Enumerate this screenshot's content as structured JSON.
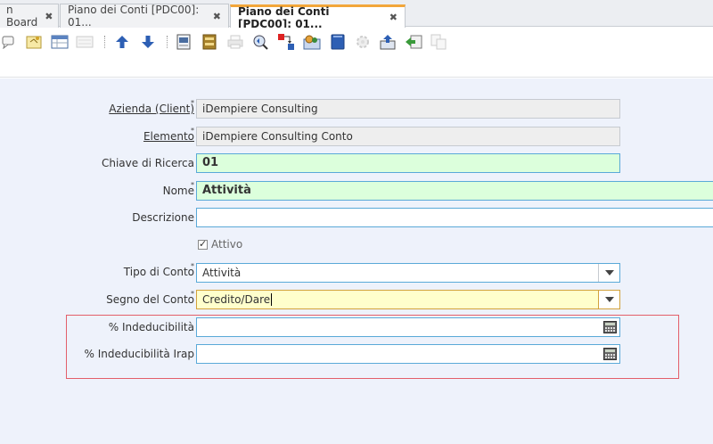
{
  "tabs": [
    {
      "label": "n Board",
      "close": "✖"
    },
    {
      "label": "Piano dei Conti [PDC00]: 01...",
      "close": "✖"
    },
    {
      "label": "Piano dei Conti [PDC00]: 01...",
      "close": "✖"
    }
  ],
  "toolbar": {
    "icons": [
      "chat-icon",
      "note-icon",
      "grid-toggle-icon",
      "multi-row-icon",
      "up-arrow-icon",
      "down-arrow-icon",
      "report-icon",
      "archive-icon",
      "print-icon",
      "zoom-across-icon",
      "request-icon",
      "product-info-icon",
      "attachment-icon",
      "workflow-icon",
      "export-icon",
      "import-icon",
      "copy-icon"
    ]
  },
  "form": {
    "client": {
      "label": "Azienda (Client)",
      "value": "iDempiere Consulting",
      "required": "*"
    },
    "element": {
      "label": "Elemento",
      "value": "iDempiere Consulting Conto",
      "required": "*"
    },
    "search_key": {
      "label": "Chiave di Ricerca",
      "value": "01"
    },
    "name": {
      "label": "Nome",
      "value": "Attività",
      "required": "*"
    },
    "description": {
      "label": "Descrizione",
      "value": ""
    },
    "active": {
      "label": "Attivo"
    },
    "account_type": {
      "label": "Tipo di Conto",
      "value": "Attività",
      "required": "*"
    },
    "account_sign": {
      "label": "Segno del Conto",
      "value": "Credito/Dare",
      "required": "*"
    },
    "nondeductibility": {
      "label": "% Indeducibilità",
      "value": ""
    },
    "nondeductibility_irap": {
      "label": "% Indeducibilità Irap",
      "value": ""
    }
  },
  "colors": {
    "active_tab_accent": "#f2a63a",
    "mandatory_bg": "#dcffdc",
    "focused_bg": "#ffffcc",
    "highlight_border": "#e35f6a",
    "form_bg": "#eef2fb"
  }
}
